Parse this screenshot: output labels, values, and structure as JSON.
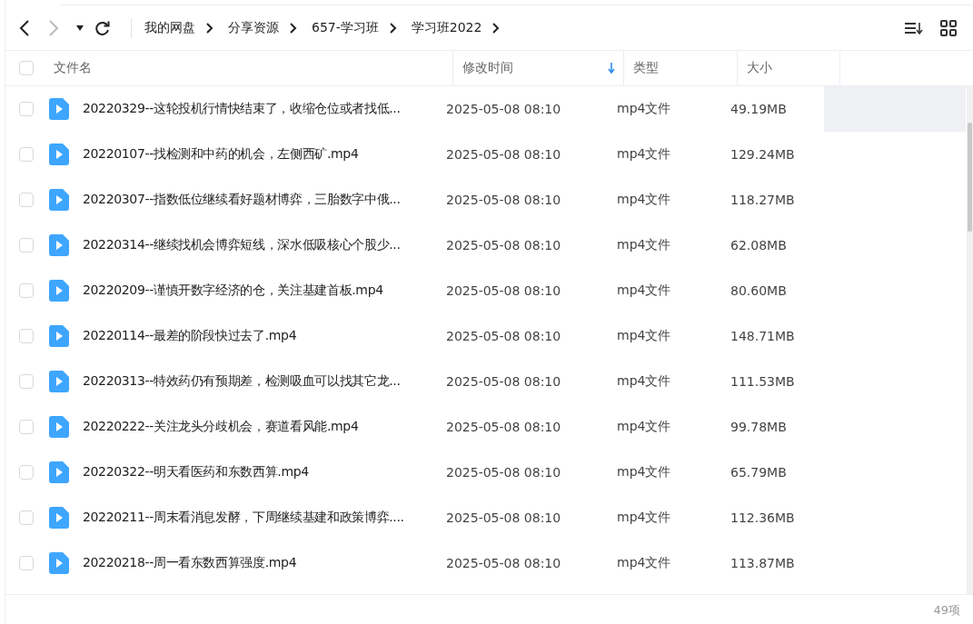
{
  "toolbar": {
    "back_disabled": false,
    "forward_disabled": true
  },
  "breadcrumbs": [
    "我的网盘",
    "分享资源",
    "657-学习班",
    "学习班2022"
  ],
  "table": {
    "columns": [
      {
        "label": "文件名",
        "sorted": false
      },
      {
        "label": "修改时间",
        "sorted": true
      },
      {
        "label": "类型",
        "sorted": false
      },
      {
        "label": "大小",
        "sorted": false
      }
    ],
    "select_all": {
      "checked": false
    },
    "rows": [
      {
        "name": "20220329--这轮投机行情快结束了，收缩仓位或者找低...",
        "modified": "2025-05-08 08:10",
        "type": "mp4文件",
        "size": "49.19MB",
        "checked": false,
        "hovered": true
      },
      {
        "name": "20220107--找检测和中药的机会，左侧西矿.mp4",
        "modified": "2025-05-08 08:10",
        "type": "mp4文件",
        "size": "129.24MB",
        "checked": false,
        "hovered": false
      },
      {
        "name": "20220307--指数低位继续看好题材博弈，三胎数字中俄...",
        "modified": "2025-05-08 08:10",
        "type": "mp4文件",
        "size": "118.27MB",
        "checked": false,
        "hovered": false
      },
      {
        "name": "20220314--继续找机会博弈短线，深水低吸核心个股少...",
        "modified": "2025-05-08 08:10",
        "type": "mp4文件",
        "size": "62.08MB",
        "checked": false,
        "hovered": false
      },
      {
        "name": "20220209--谨慎开数字经济的仓，关注基建首板.mp4",
        "modified": "2025-05-08 08:10",
        "type": "mp4文件",
        "size": "80.60MB",
        "checked": false,
        "hovered": false
      },
      {
        "name": "20220114--最差的阶段快过去了.mp4",
        "modified": "2025-05-08 08:10",
        "type": "mp4文件",
        "size": "148.71MB",
        "checked": false,
        "hovered": false
      },
      {
        "name": "20220313--特效药仍有预期差，检测吸血可以找其它龙...",
        "modified": "2025-05-08 08:10",
        "type": "mp4文件",
        "size": "111.53MB",
        "checked": false,
        "hovered": false
      },
      {
        "name": "20220222--关注龙头分歧机会，赛道看风能.mp4",
        "modified": "2025-05-08 08:10",
        "type": "mp4文件",
        "size": "99.78MB",
        "checked": false,
        "hovered": false
      },
      {
        "name": "20220322--明天看医药和东数西算.mp4",
        "modified": "2025-05-08 08:10",
        "type": "mp4文件",
        "size": "65.79MB",
        "checked": false,
        "hovered": false
      },
      {
        "name": "20220211--周末看消息发酵，下周继续基建和政策博弈....",
        "modified": "2025-05-08 08:10",
        "type": "mp4文件",
        "size": "112.36MB",
        "checked": false,
        "hovered": false
      },
      {
        "name": "20220218--周一看东数西算强度.mp4",
        "modified": "2025-05-08 08:10",
        "type": "mp4文件",
        "size": "113.87MB",
        "checked": false,
        "hovered": false
      }
    ]
  },
  "status_bar": {
    "count": "49项"
  }
}
